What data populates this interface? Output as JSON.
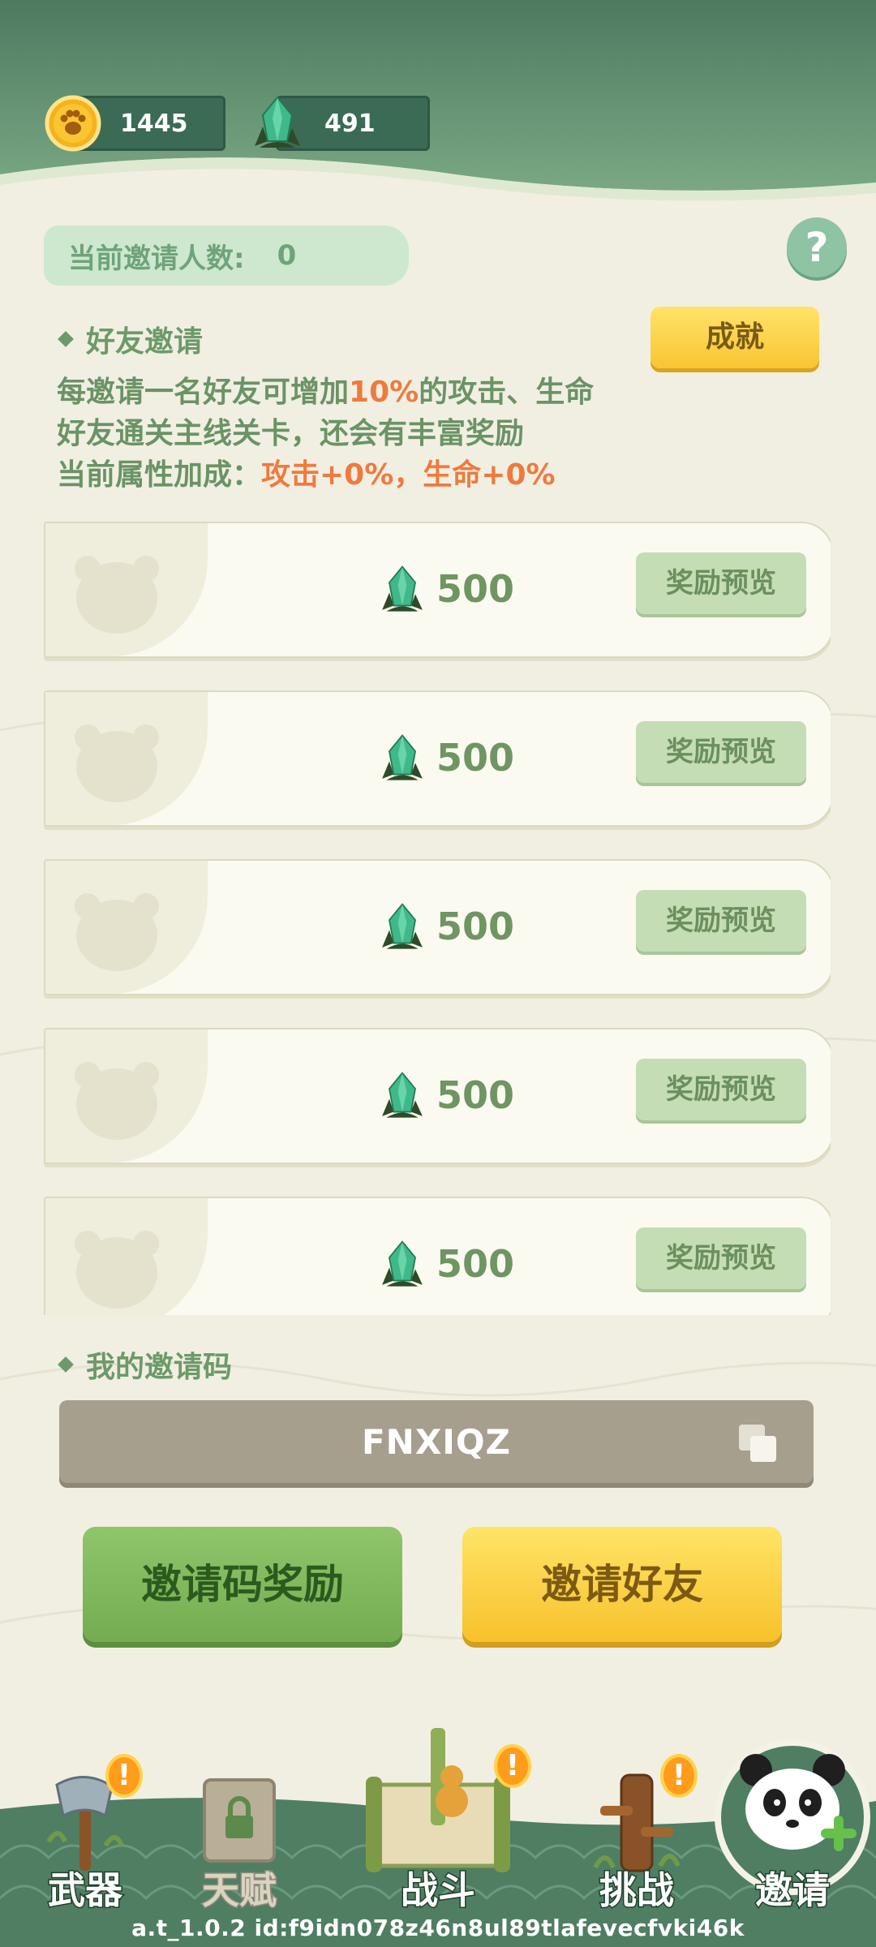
{
  "header": {
    "coins": "1445",
    "gems": "491"
  },
  "invite": {
    "count_label": "当前邀请人数:",
    "count_value": "0",
    "help_label": "?",
    "section_title": "好友邀请",
    "achievement_label": "成就",
    "desc_line1_a": "每邀请一名好友可增加",
    "desc_line1_hl": "10%",
    "desc_line1_b": "的攻击、生命",
    "desc_line2": "好友通关主线关卡，还会有丰富奖励",
    "desc_line3_a": "当前属性加成：",
    "desc_line3_hl": "攻击+0%，生命+0%"
  },
  "rewards": [
    {
      "amount": "500",
      "preview_label": "奖励预览"
    },
    {
      "amount": "500",
      "preview_label": "奖励预览"
    },
    {
      "amount": "500",
      "preview_label": "奖励预览"
    },
    {
      "amount": "500",
      "preview_label": "奖励预览"
    },
    {
      "amount": "500",
      "preview_label": "奖励预览"
    }
  ],
  "code_section": {
    "title": "我的邀请码",
    "code": "FNXIQZ"
  },
  "actions": {
    "code_reward_label": "邀请码奖励",
    "invite_friend_label": "邀请好友"
  },
  "nav": {
    "weapon": "武器",
    "talent": "天赋",
    "battle": "战斗",
    "challenge": "挑战",
    "invite": "邀请",
    "badge_mark": "!"
  },
  "footer": {
    "version": "a.t_1.0.2 id:f9idn078z46n8ul89tlafevecfvki46k"
  },
  "colors": {
    "header_green": "#4f7e63",
    "accent_orange": "#ef7a3e",
    "button_yellow": "#f9c531",
    "button_green": "#7fb65c"
  }
}
